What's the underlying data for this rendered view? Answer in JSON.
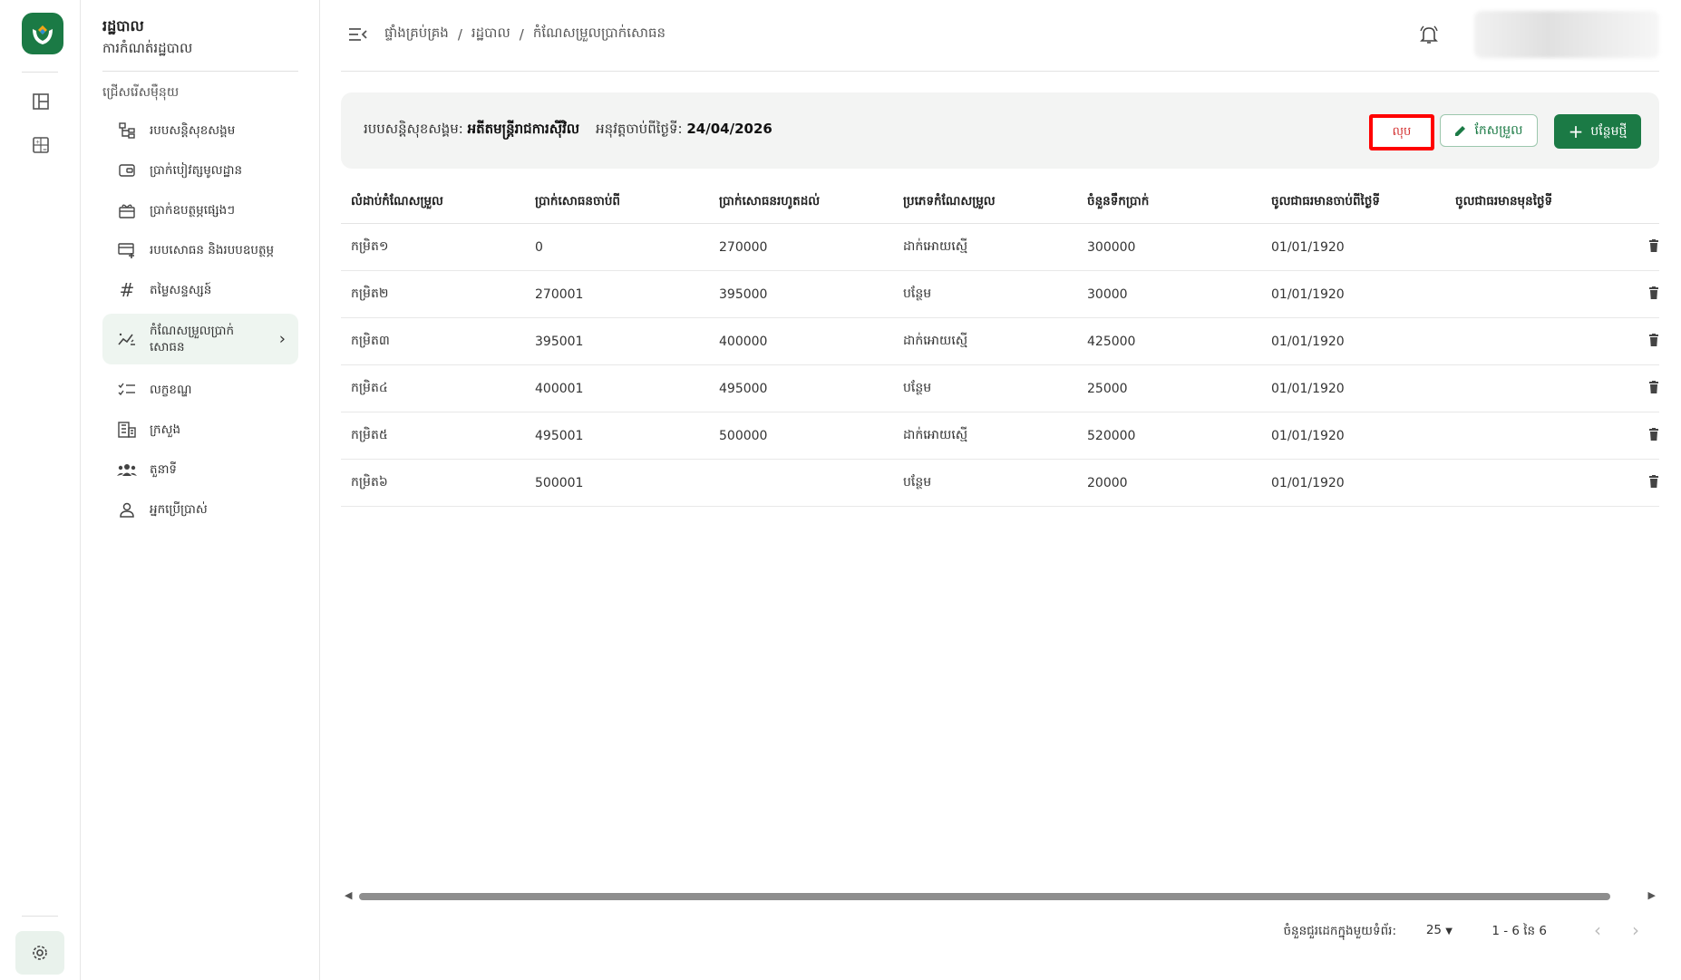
{
  "app": {
    "title": "រដ្ឋបាល",
    "subtitle": "ការកំណត់រដ្ឋបាល",
    "section_label": "ជ្រើសរើសម៉ឺនុយ"
  },
  "sidebar": {
    "items": [
      {
        "label": "របបសន្តិសុខសង្គម",
        "icon": "hierarchy-icon"
      },
      {
        "label": "ប្រាក់បៀវត្សមូលដ្ឋាន",
        "icon": "wallet-icon"
      },
      {
        "label": "ប្រាក់ឧបត្ថម្ភផ្សេងៗ",
        "icon": "gift-icon"
      },
      {
        "label": "របបសោធន និងរបបឧបត្ថម្ភ",
        "icon": "card-plus-icon"
      },
      {
        "label": "តម្លៃសន្ទស្សន៍",
        "icon": "hash-icon"
      },
      {
        "label": "កំណែសម្រួលប្រាក់សោធន",
        "icon": "sparkline-icon"
      },
      {
        "label": "លក្ខខណ្ឌ",
        "icon": "checklist-icon"
      },
      {
        "label": "ក្រសួង",
        "icon": "building-icon"
      },
      {
        "label": "តួនាទី",
        "icon": "group-icon"
      },
      {
        "label": "អ្នកប្រើប្រាស់",
        "icon": "person-icon"
      }
    ]
  },
  "breadcrumb": {
    "items": [
      "ផ្ទាំងគ្រប់គ្រង",
      "រដ្ឋបាល",
      "កំណែសម្រួលប្រាក់សោធន"
    ],
    "separator": "/"
  },
  "info": {
    "scheme_label": "របបសន្តិសុខសង្គម:",
    "scheme_value": "អតីតមន្ត្រីរាជការស៊ីវិល",
    "effective_label": "អនុវត្តចាប់ពីថ្ងៃទី:",
    "effective_value": "24/04/2026"
  },
  "actions": {
    "delete": "លុប",
    "edit": "កែសម្រួល",
    "new": "បន្ថែមថ្មី"
  },
  "table": {
    "headers": [
      "លំដាប់កំណែសម្រួល",
      "ប្រាក់សោធនចាប់ពី",
      "ប្រាក់សោធនរហូតដល់",
      "ប្រភេទកំណែសម្រួល",
      "ចំនួនទឹកប្រាក់",
      "ចូលជាធរមានចាប់ពីថ្ងៃទី",
      "ចូលជាធរមានមុនថ្ងៃទី"
    ],
    "rows": [
      [
        "កម្រិត១",
        "0",
        "270000",
        "ដាក់អោយស្មើ",
        "300000",
        "01/01/1920",
        ""
      ],
      [
        "កម្រិត២",
        "270001",
        "395000",
        "បន្ថែម",
        "30000",
        "01/01/1920",
        ""
      ],
      [
        "កម្រិត៣",
        "395001",
        "400000",
        "ដាក់អោយស្មើ",
        "425000",
        "01/01/1920",
        ""
      ],
      [
        "កម្រិត៤",
        "400001",
        "495000",
        "បន្ថែម",
        "25000",
        "01/01/1920",
        ""
      ],
      [
        "កម្រិត៥",
        "495001",
        "500000",
        "ដាក់អោយស្មើ",
        "520000",
        "01/01/1920",
        ""
      ],
      [
        "កម្រិត៦",
        "500001",
        "",
        "បន្ថែម",
        "20000",
        "01/01/1920",
        ""
      ]
    ]
  },
  "pagination": {
    "rows_per_page_label": "ចំនួនជួរដេកក្នុងមួយទំព័រ:",
    "rows_per_page": "25",
    "range": "1 - 6 នៃ 6"
  },
  "colors": {
    "primary": "#1b7a45",
    "danger": "#d32f2f",
    "highlight": "#ff0000"
  }
}
